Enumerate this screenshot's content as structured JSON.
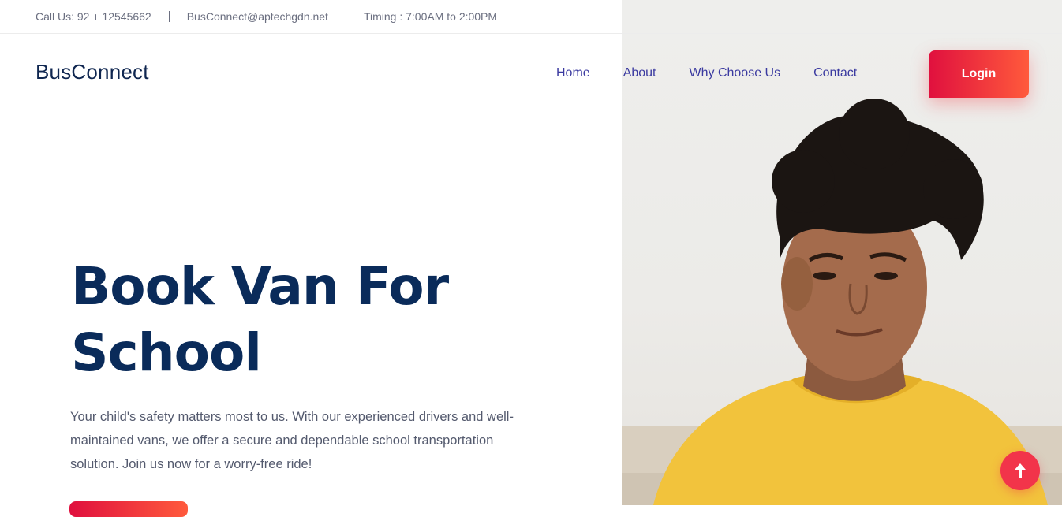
{
  "topbar": {
    "phone": "Call Us: 92 + 12545662",
    "email": "BusConnect@aptechgdn.net",
    "timing": "Timing : 7:00AM to 2:00PM"
  },
  "brand": "BusConnect",
  "nav": {
    "items": [
      "Home",
      "About",
      "Why Choose Us",
      "Contact"
    ],
    "login_label": "Login"
  },
  "hero": {
    "title_line1": "Book Van For",
    "title_line2": "School",
    "description": "Your child's safety matters most to us. With our experienced drivers and well-maintained vans, we offer a secure and dependable school transportation solution. Join us now for a worry-free ride!"
  },
  "colors": {
    "accent_start": "#e0103e",
    "accent_end": "#ff5a3c",
    "heading": "#0a2b5a",
    "nav_link": "#3b3aa0"
  },
  "icons": {
    "back_to_top": "arrow-up-icon"
  }
}
